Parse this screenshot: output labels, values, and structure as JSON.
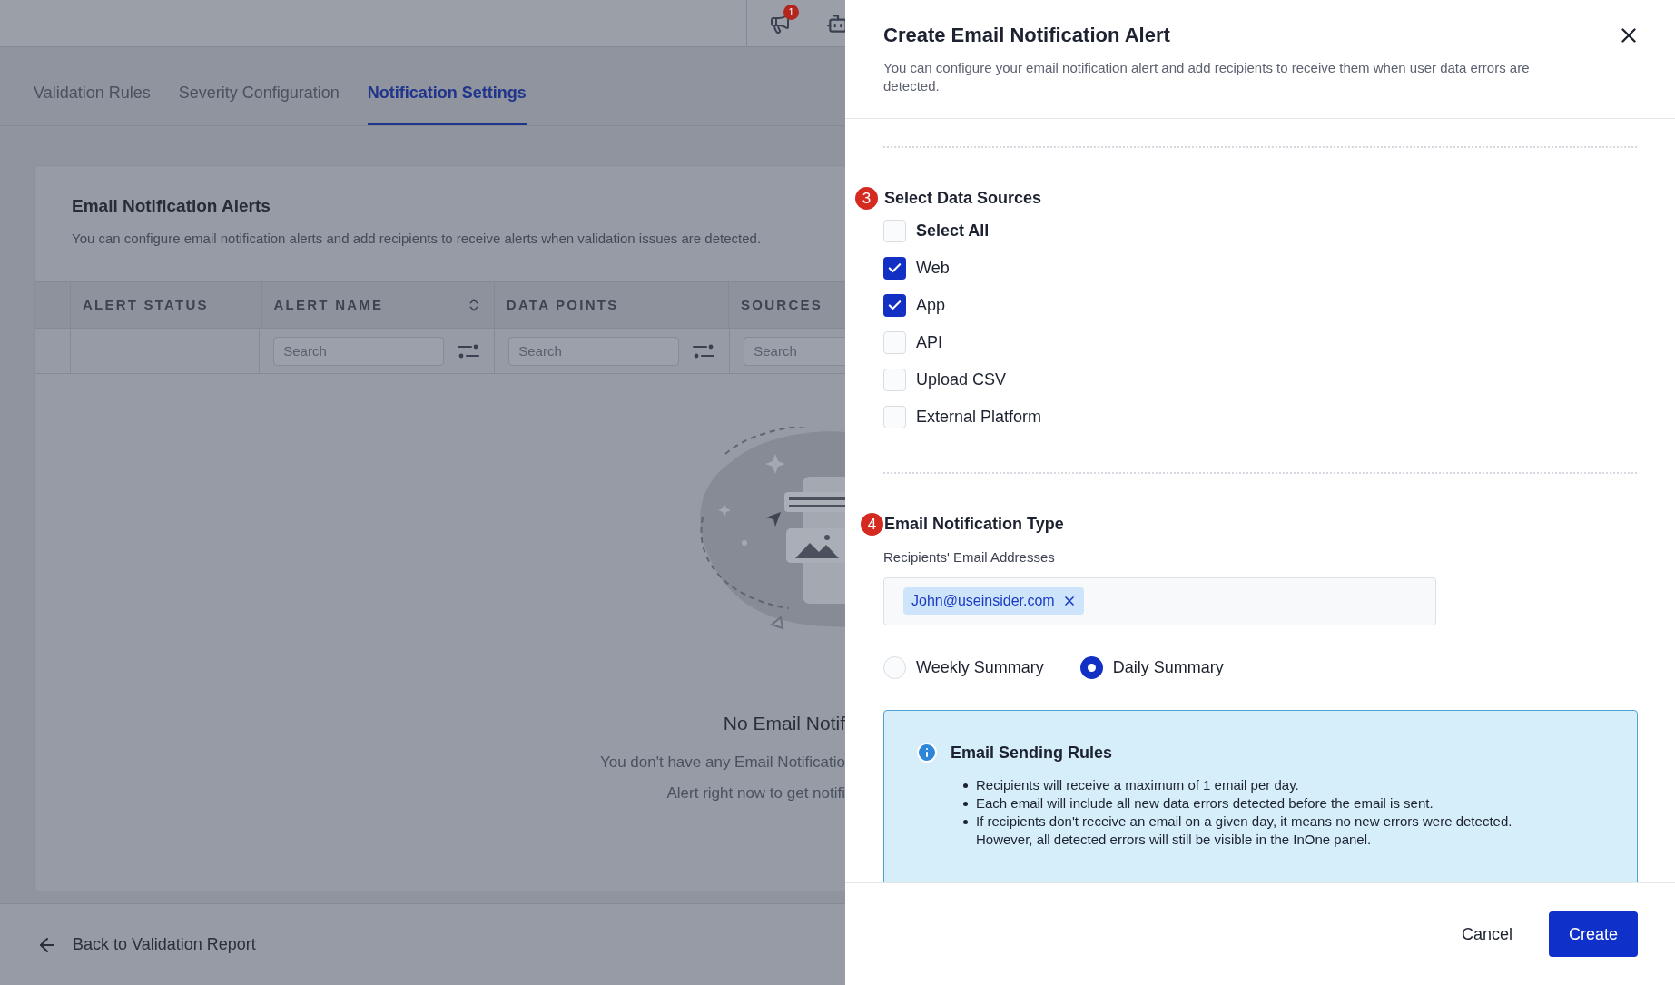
{
  "top_bar": {
    "notification_badge": "1"
  },
  "tabs": [
    {
      "label": "Validation Rules",
      "selected": false
    },
    {
      "label": "Severity Configuration",
      "selected": false
    },
    {
      "label": "Notification Settings",
      "selected": true
    }
  ],
  "card": {
    "title": "Email Notification Alerts",
    "description": "You can configure email notification alerts and add recipients to receive alerts when validation issues are detected."
  },
  "table": {
    "columns": [
      {
        "label": "ALERT STATUS"
      },
      {
        "label": "ALERT NAME",
        "sortable": true
      },
      {
        "label": "DATA POINTS"
      },
      {
        "label": "SOURCES"
      }
    ],
    "filters": [
      {
        "placeholder": "Search",
        "filter_icon": true
      },
      {
        "placeholder": "Search",
        "filter_icon": true
      },
      {
        "placeholder": "Search",
        "filter_icon": false
      }
    ]
  },
  "empty_state": {
    "title": "No Email Notif",
    "lines": [
      "You don't have any Email Notificatio",
      "Alert right now to get notifi"
    ]
  },
  "footer": {
    "back_link": "Back to Validation Report"
  },
  "drawer": {
    "title": "Create Email Notification Alert",
    "description": "You can configure your email notification alert and add recipients to receive them when user data errors are detected.",
    "sources_step": {
      "number": "3",
      "title": "Select Data Sources",
      "options": [
        {
          "label": "Select All",
          "kind": "select_all",
          "checked": false
        },
        {
          "label": "Web",
          "kind": "option",
          "checked": true
        },
        {
          "label": "App",
          "kind": "option",
          "checked": true
        },
        {
          "label": "API",
          "kind": "option",
          "checked": false
        },
        {
          "label": "Upload CSV",
          "kind": "option",
          "checked": false
        },
        {
          "label": "External Platform",
          "kind": "option",
          "checked": false
        }
      ]
    },
    "type_step": {
      "number": "4",
      "title": "Email Notification Type",
      "recipients_label": "Recipients' Email Addresses",
      "recipients": [
        "John@useinsider.com"
      ],
      "frequency": [
        {
          "label": "Weekly Summary",
          "selected": false
        },
        {
          "label": "Daily Summary",
          "selected": true
        }
      ]
    },
    "rules": {
      "title": "Email Sending Rules",
      "bullets": [
        {
          "lines": [
            "Recipients will receive a maximum of 1 email per day."
          ]
        },
        {
          "lines": [
            "Each email will include all new data errors detected before the email is sent."
          ]
        },
        {
          "lines": [
            "If recipients don't receive an email on a given day, it means no new errors were detected.",
            "However, all detected errors will still be visible in the InOne panel."
          ]
        }
      ]
    },
    "buttons": {
      "cancel": "Cancel",
      "create": "Create"
    }
  }
}
